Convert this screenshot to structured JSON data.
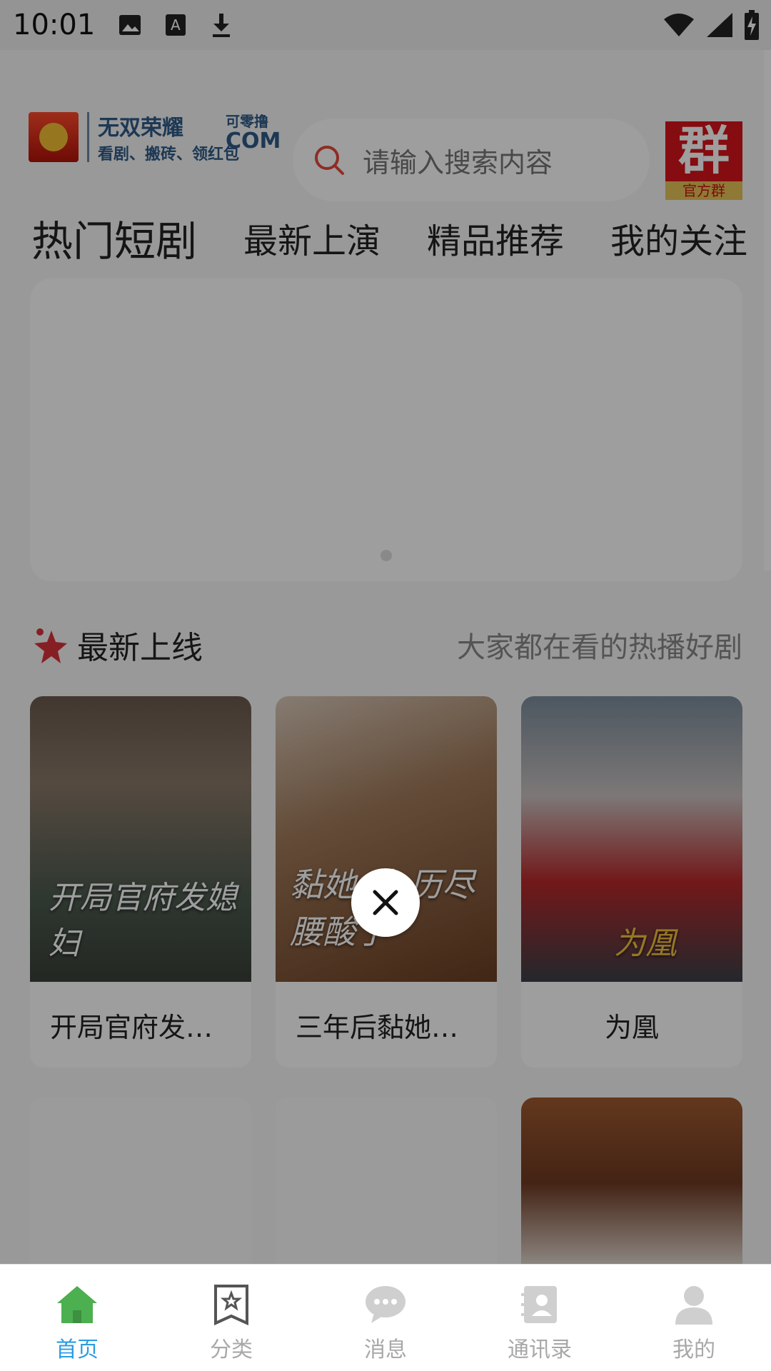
{
  "status_bar": {
    "time": "10:01",
    "icons": [
      "image-icon",
      "a-icon",
      "download-icon",
      "wifi-icon",
      "signal-icon",
      "battery-charging-icon"
    ]
  },
  "header": {
    "logo": {
      "line1": "无双荣耀",
      "line2": "看剧、搬砖、领红包",
      "com_top": "可零撸",
      "com_bottom": "COM"
    },
    "search_placeholder": "请输入搜索内容",
    "group_badge": {
      "big": "群",
      "small": "官方群"
    }
  },
  "tabs": [
    {
      "label": "热门短剧",
      "active": true
    },
    {
      "label": "最新上演",
      "active": false
    },
    {
      "label": "精品推荐",
      "active": false
    },
    {
      "label": "我的关注",
      "active": false
    }
  ],
  "section": {
    "title": "最新上线",
    "subtitle": "大家都在看的热播好剧"
  },
  "cards": [
    {
      "title": "开局官府发…",
      "poster_text": "开局官府发媳妇"
    },
    {
      "title": "三年后黏她…",
      "poster_text": "黏她 的 历尽腰酸了"
    },
    {
      "title": "为凰",
      "poster_text": "为凰"
    }
  ],
  "bottom_nav": [
    {
      "label": "首页",
      "icon": "home-icon",
      "active": true
    },
    {
      "label": "分类",
      "icon": "category-icon",
      "active": false
    },
    {
      "label": "消息",
      "icon": "message-icon",
      "active": false
    },
    {
      "label": "通讯录",
      "icon": "contacts-icon",
      "active": false
    },
    {
      "label": "我的",
      "icon": "profile-icon",
      "active": false
    }
  ],
  "colors": {
    "accent": "#2c9de0",
    "home_green": "#4caf50",
    "badge_red": "#d7141a"
  }
}
